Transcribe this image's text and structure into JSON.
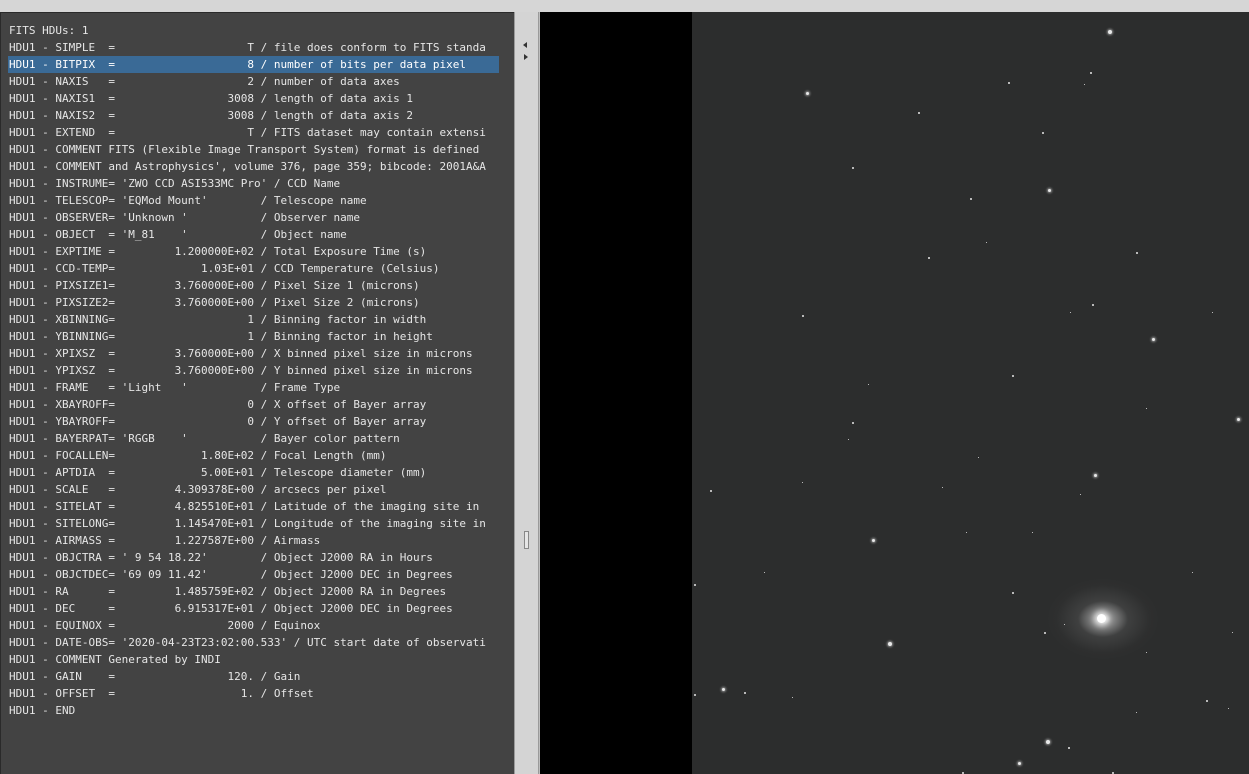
{
  "fits_header": {
    "title": "FITS HDUs: 1",
    "selected_index": 1,
    "lines": [
      "HDU1 - SIMPLE  =                    T / file does conform to FITS standa",
      "HDU1 - BITPIX  =                    8 / number of bits per data pixel",
      "HDU1 - NAXIS   =                    2 / number of data axes",
      "HDU1 - NAXIS1  =                 3008 / length of data axis 1",
      "HDU1 - NAXIS2  =                 3008 / length of data axis 2",
      "HDU1 - EXTEND  =                    T / FITS dataset may contain extensi",
      "HDU1 - COMMENT FITS (Flexible Image Transport System) format is defined",
      "HDU1 - COMMENT and Astrophysics', volume 376, page 359; bibcode: 2001A&A",
      "HDU1 - INSTRUME= 'ZWO CCD ASI533MC Pro' / CCD Name",
      "HDU1 - TELESCOP= 'EQMod Mount'        / Telescope name",
      "HDU1 - OBSERVER= 'Unknown '           / Observer name",
      "HDU1 - OBJECT  = 'M_81    '           / Object name",
      "HDU1 - EXPTIME =         1.200000E+02 / Total Exposure Time (s)",
      "HDU1 - CCD-TEMP=             1.03E+01 / CCD Temperature (Celsius)",
      "HDU1 - PIXSIZE1=         3.760000E+00 / Pixel Size 1 (microns)",
      "HDU1 - PIXSIZE2=         3.760000E+00 / Pixel Size 2 (microns)",
      "HDU1 - XBINNING=                    1 / Binning factor in width",
      "HDU1 - YBINNING=                    1 / Binning factor in height",
      "HDU1 - XPIXSZ  =         3.760000E+00 / X binned pixel size in microns",
      "HDU1 - YPIXSZ  =         3.760000E+00 / Y binned pixel size in microns",
      "HDU1 - FRAME   = 'Light   '           / Frame Type",
      "HDU1 - XBAYROFF=                    0 / X offset of Bayer array",
      "HDU1 - YBAYROFF=                    0 / Y offset of Bayer array",
      "HDU1 - BAYERPAT= 'RGGB    '           / Bayer color pattern",
      "HDU1 - FOCALLEN=             1.80E+02 / Focal Length (mm)",
      "HDU1 - APTDIA  =             5.00E+01 / Telescope diameter (mm)",
      "HDU1 - SCALE   =         4.309378E+00 / arcsecs per pixel",
      "HDU1 - SITELAT =         4.825510E+01 / Latitude of the imaging site in",
      "HDU1 - SITELONG=         1.145470E+01 / Longitude of the imaging site in",
      "HDU1 - AIRMASS =         1.227587E+00 / Airmass",
      "HDU1 - OBJCTRA = ' 9 54 18.22'        / Object J2000 RA in Hours",
      "HDU1 - OBJCTDEC= '69 09 11.42'        / Object J2000 DEC in Degrees",
      "HDU1 - RA      =         1.485759E+02 / Object J2000 RA in Degrees",
      "HDU1 - DEC     =         6.915317E+01 / Object J2000 DEC in Degrees",
      "HDU1 - EQUINOX =                 2000 / Equinox",
      "HDU1 - DATE-OBS= '2020-04-23T23:02:00.533' / UTC start date of observati",
      "HDU1 - COMMENT Generated by INDI",
      "HDU1 - GAIN    =                 120. / Gain",
      "HDU1 - OFFSET  =                   1. / Offset",
      "HDU1 - END"
    ]
  },
  "colors": {
    "panel_bg": "#434343",
    "selection": "#3a6a96",
    "sky": "#2c2d2d"
  }
}
